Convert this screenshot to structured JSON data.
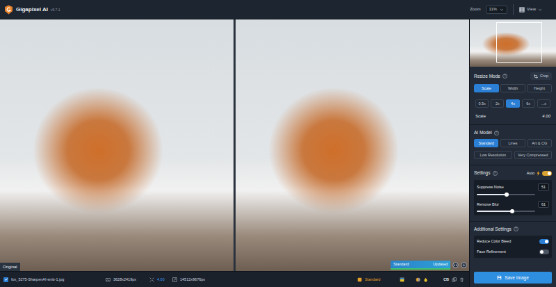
{
  "header": {
    "app_name": "Gigapixel AI",
    "version": "v5.7.1",
    "zoom_label": "Zoom",
    "zoom_value": "11%",
    "view_label": "View"
  },
  "preview": {
    "original_label": "Original",
    "model_label": "Standard",
    "status_label": "Updated"
  },
  "status_bar": {
    "selected": true,
    "file_name": "fox_5275-SharpenAI-smb-1.jpg",
    "input_size": "3628x2419px",
    "scale": "4.00",
    "output_size": "14512x9676px",
    "model": "Standard",
    "cb": "CB"
  },
  "sidebar": {
    "resize_mode": {
      "title": "Resize Mode",
      "help": "?",
      "crop_label": "Crop",
      "modes": [
        {
          "label": "Scale",
          "selected": true
        },
        {
          "label": "Width",
          "selected": false
        },
        {
          "label": "Height",
          "selected": false
        }
      ],
      "scales": [
        {
          "label": "0.5x",
          "selected": false
        },
        {
          "label": "2x",
          "selected": false
        },
        {
          "label": "4x",
          "selected": true
        },
        {
          "label": "6x",
          "selected": false
        },
        {
          "label": "...x",
          "selected": false
        }
      ],
      "scale_label": "Scale",
      "scale_value": "4.00"
    },
    "ai_model": {
      "title": "AI Model",
      "help": "?",
      "models": [
        {
          "label": "Standard",
          "selected": true
        },
        {
          "label": "Lines",
          "selected": false
        },
        {
          "label": "Art & CG",
          "selected": false
        },
        {
          "label": "Low Resolution",
          "selected": false
        },
        {
          "label": "Very Compressed",
          "selected": false
        }
      ]
    },
    "settings": {
      "title": "Settings",
      "help": "?",
      "auto_label": "Auto",
      "auto_on": true,
      "sliders": [
        {
          "label": "Suppress Noise",
          "level": 0.51,
          "reading": "51"
        },
        {
          "label": "Remove Blur",
          "level": 0.61,
          "reading": "61"
        }
      ]
    },
    "additional_settings": {
      "title": "Additional Settings",
      "help": "?",
      "toggles": [
        {
          "label": "Reduce Color Bleed",
          "on": true
        },
        {
          "label": "Face Refinement",
          "on": false
        }
      ]
    },
    "save_label": "Save Image"
  }
}
